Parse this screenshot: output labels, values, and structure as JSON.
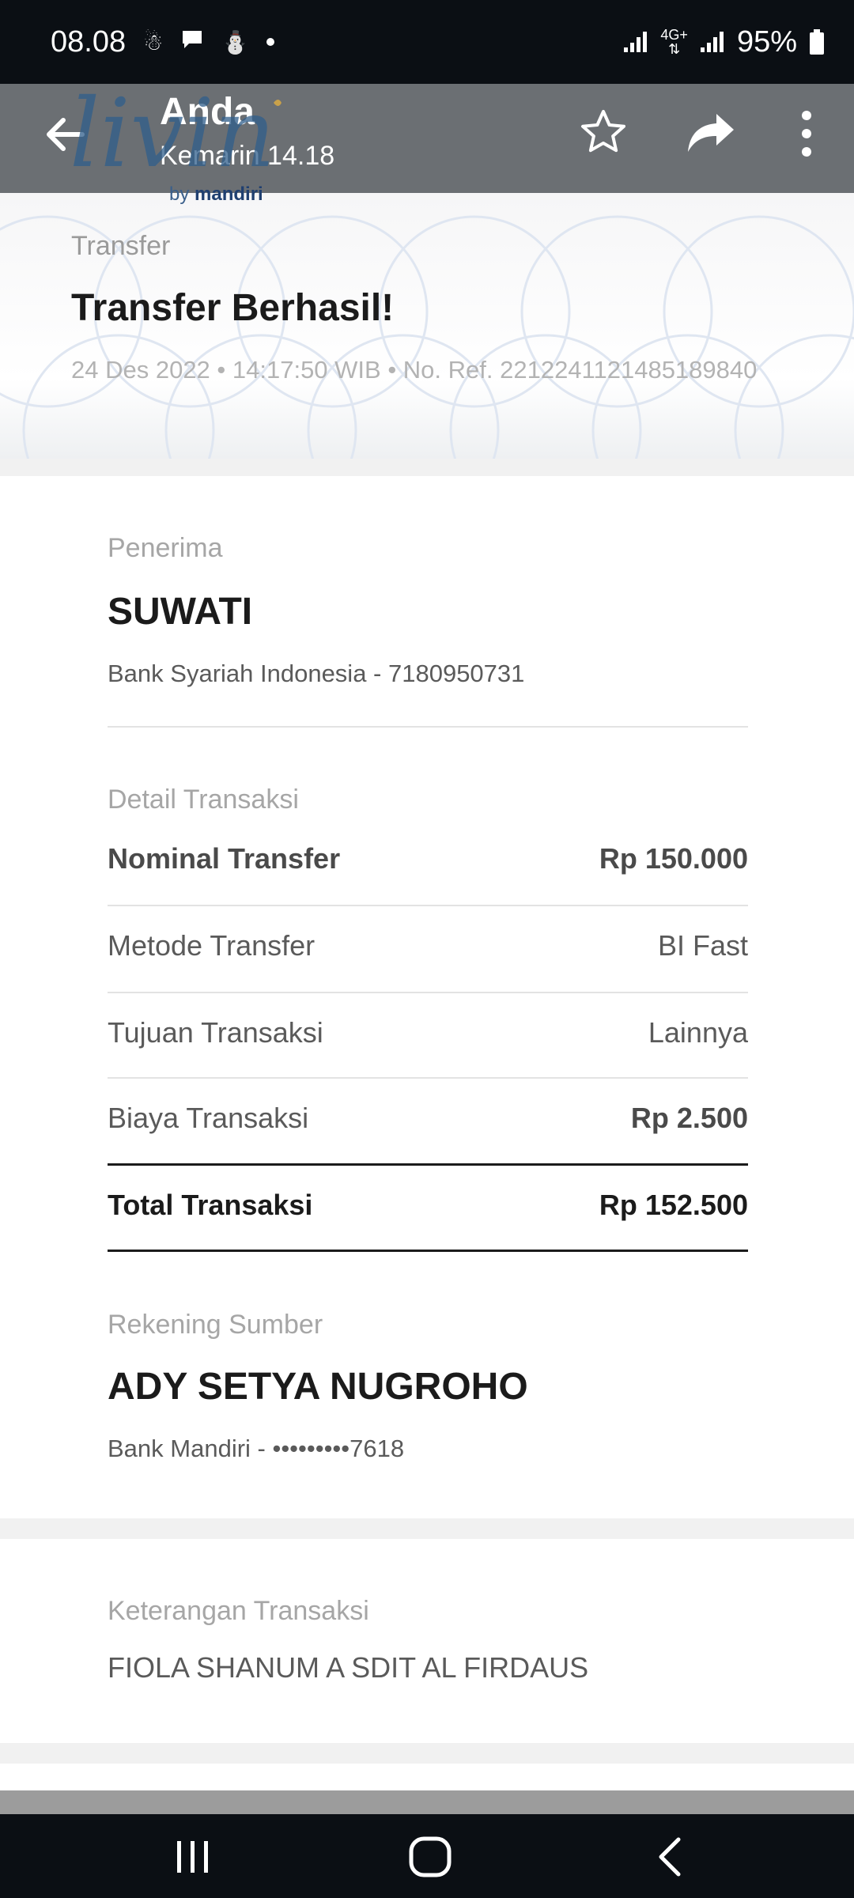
{
  "status_bar": {
    "time": "08.08",
    "network": "4G+",
    "battery": "95%",
    "icons": [
      "snowman-icon",
      "chat-bubble-icon",
      "notification-icon",
      "dot-icon",
      "signal-icon",
      "battery-icon"
    ]
  },
  "viewer": {
    "sender": "Anda",
    "timestamp": "Kemarin 14.18",
    "brand_sub_prefix": "by",
    "brand_sub_name": "mandiri"
  },
  "receipt": {
    "kicker": "Transfer",
    "title": "Transfer Berhasil!",
    "meta": "24 Des 2022 • 14:17:50 WIB • No. Ref. 2212241121485189840",
    "recipient": {
      "label": "Penerima",
      "name": "SUWATI",
      "bank": "Bank Syariah Indonesia - 7180950731"
    },
    "details": {
      "label": "Detail Transaksi",
      "rows": [
        {
          "key": "Nominal Transfer",
          "value": "Rp 150.000"
        },
        {
          "key": "Metode Transfer",
          "value": "BI Fast"
        },
        {
          "key": "Tujuan Transaksi",
          "value": "Lainnya"
        },
        {
          "key": "Biaya Transaksi",
          "value": "Rp 2.500"
        }
      ],
      "total_key": "Total Transaksi",
      "total_value": "Rp 152.500"
    },
    "source": {
      "label": "Rekening Sumber",
      "name": "ADY SETYA NUGROHO",
      "bank": "Bank Mandiri - •••••••••7618"
    },
    "note": {
      "label": "Keterangan Transaksi",
      "text": "FIOLA SHANUM A SDIT AL FIRDAUS"
    }
  },
  "colors": {
    "status_bg": "#0b0f14",
    "topbar_bg": "#6b6f73",
    "brand_blue": "#1f3f70",
    "text_dark": "#1b1b1b",
    "text_muted": "#a6a6a6"
  }
}
